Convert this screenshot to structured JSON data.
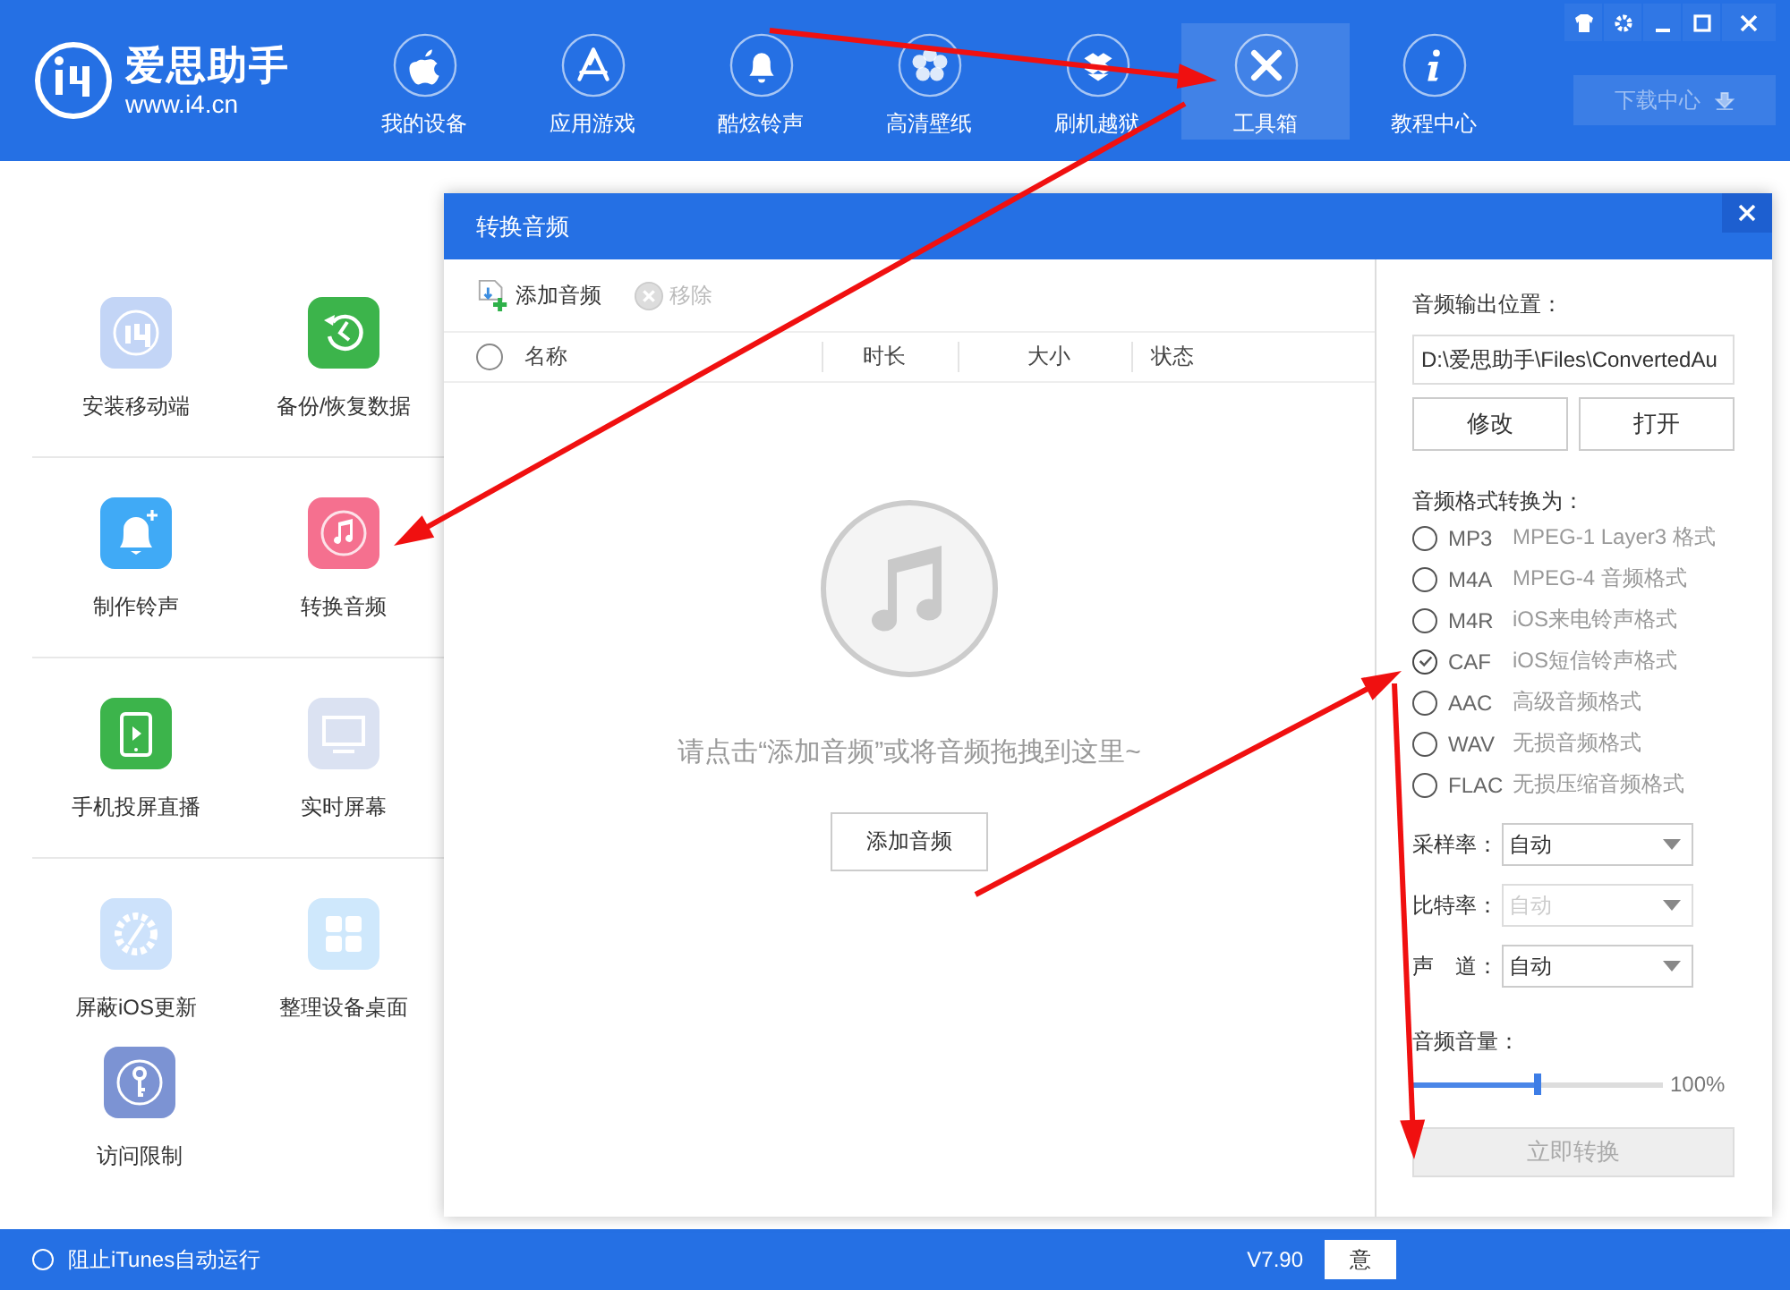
{
  "app": {
    "logo_name": "爱思助手",
    "logo_url": "www.i4.cn"
  },
  "nav": [
    {
      "label": "我的设备",
      "selected": false
    },
    {
      "label": "应用游戏",
      "selected": false
    },
    {
      "label": "酷炫铃声",
      "selected": false
    },
    {
      "label": "高清壁纸",
      "selected": false
    },
    {
      "label": "刷机越狱",
      "selected": false
    },
    {
      "label": "工具箱",
      "selected": true
    },
    {
      "label": "教程中心",
      "selected": false
    }
  ],
  "download_button": "下载中心",
  "tools": [
    {
      "label": "安装移动端",
      "color": "#c3d5f6"
    },
    {
      "label": "备份/恢复数据",
      "color": "#3cb44b"
    },
    {
      "label": "制作铃声",
      "color": "#40aaf6"
    },
    {
      "label": "转换音频",
      "color": "#f5708f"
    },
    {
      "label": "手机投屏直播",
      "color": "#3cb44b"
    },
    {
      "label": "实时屏幕",
      "color": "#dbe2f2"
    },
    {
      "label": "屏蔽iOS更新",
      "color": "#cde2fb"
    },
    {
      "label": "整理设备桌面",
      "color": "#cfe8fc"
    },
    {
      "label": "访问限制",
      "color": "#7c93d3"
    }
  ],
  "dialog": {
    "title": "转换音频",
    "toolbar": [
      {
        "label": "添加音频",
        "disabled": false
      },
      {
        "label": "移除",
        "disabled": true
      }
    ],
    "select_all": {
      "checked": false
    },
    "columns": [
      "名称",
      "时长",
      "大小",
      "状态"
    ],
    "empty_text": "请点击“添加音频”或将音频拖拽到这里~",
    "add_button": "添加音频",
    "output_label": "音频输出位置：",
    "output_path": "D:\\爱思助手\\Files\\ConvertedAu",
    "path_buttons": [
      "修改",
      "打开"
    ],
    "format_label": "音频格式转换为：",
    "formats": [
      {
        "code": "MP3",
        "desc": "MPEG-1 Layer3 格式",
        "selected": false
      },
      {
        "code": "M4A",
        "desc": "MPEG-4 音频格式",
        "selected": false
      },
      {
        "code": "M4R",
        "desc": "iOS来电铃声格式",
        "selected": false
      },
      {
        "code": "CAF",
        "desc": "iOS短信铃声格式",
        "selected": true
      },
      {
        "code": "AAC",
        "desc": "高级音频格式",
        "selected": false
      },
      {
        "code": "WAV",
        "desc": "无损音频格式",
        "selected": false
      },
      {
        "code": "FLAC",
        "desc": "无损压缩音频格式",
        "selected": false
      }
    ],
    "selects": [
      {
        "label": "采样率：",
        "value": "自动",
        "disabled": false
      },
      {
        "label": "比特率：",
        "value": "自动",
        "disabled": true
      },
      {
        "label": "声　道：",
        "value": "自动",
        "disabled": false
      }
    ],
    "volume": {
      "label": "音频音量：",
      "level": 0.5,
      "reading": "100%"
    },
    "convert_button": {
      "label": "立即转换",
      "disabled": true
    }
  },
  "status_bar": {
    "itunes": {
      "label": "阻止iTunes自动运行",
      "checked": false
    },
    "version": "V7.90",
    "button": "意"
  }
}
